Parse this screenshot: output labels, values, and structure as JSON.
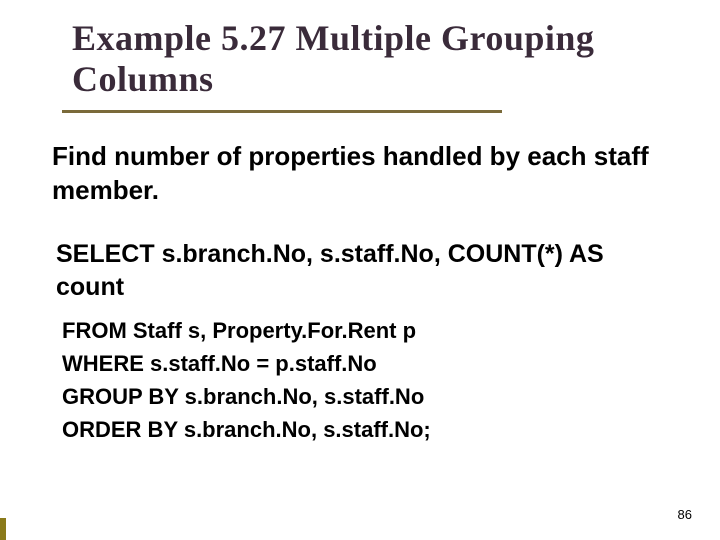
{
  "title": "Example 5.27  Multiple Grouping Columns",
  "lead": "Find number of properties handled by each staff member.",
  "sql_main": "SELECT s.branch.No, s.staff.No, COUNT(*) AS count",
  "sql_lines": {
    "l0": "FROM Staff s, Property.For.Rent p",
    "l1": "WHERE s.staff.No = p.staff.No",
    "l2": "GROUP BY s.branch.No, s.staff.No",
    "l3": "ORDER BY s.branch.No, s.staff.No;"
  },
  "page_number": "86"
}
